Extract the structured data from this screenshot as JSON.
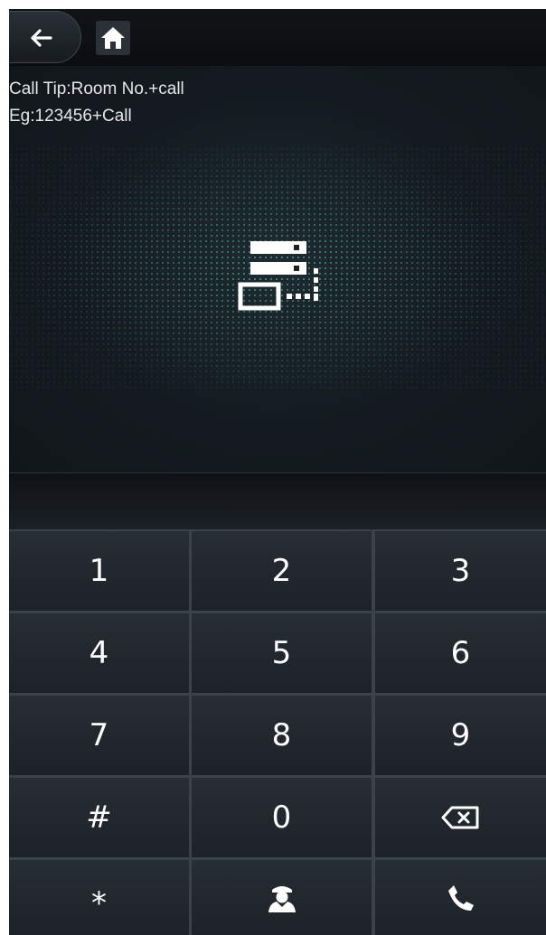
{
  "topbar": {
    "back_icon": "arrow-left-icon",
    "home_icon": "home-icon"
  },
  "tip": {
    "line1": "Call Tip:Room No.+call",
    "line2": "Eg:123456+Call",
    "icon": "server-network-icon"
  },
  "input": {
    "value": ""
  },
  "keypad": {
    "keys": [
      "1",
      "2",
      "3",
      "4",
      "5",
      "6",
      "7",
      "8",
      "9",
      "#",
      "0",
      "*"
    ],
    "backspace_icon": "backspace-icon",
    "manager_icon": "call-manager-icon",
    "call_icon": "phone-icon"
  },
  "colors": {
    "background": "#1a1f24",
    "key_bg": "#22292f",
    "text": "#ffffff",
    "accent_dots": "#3a8a7e"
  }
}
